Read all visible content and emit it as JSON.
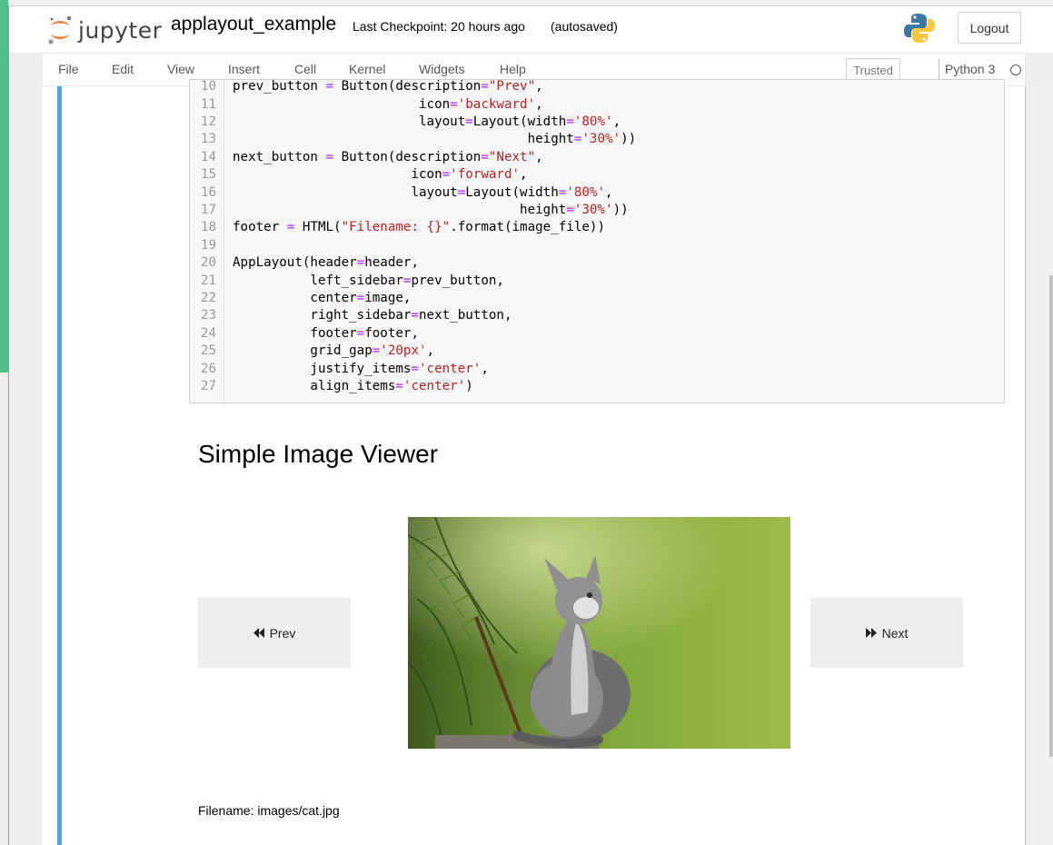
{
  "header": {
    "logo_text": "jupyter",
    "notebook_name": "applayout_example",
    "checkpoint": "Last Checkpoint: 20 hours ago",
    "autosave": "(autosaved)",
    "logout_label": "Logout"
  },
  "menu": {
    "items": [
      "File",
      "Edit",
      "View",
      "Insert",
      "Cell",
      "Kernel",
      "Widgets",
      "Help"
    ],
    "trusted_label": "Trusted",
    "kernel_name": "Python 3"
  },
  "code": {
    "partial_line": "prev_button = Button(description=\"Prev\",",
    "lines": [
      {
        "n": "11",
        "t": "                        icon='backward',"
      },
      {
        "n": "12",
        "t": "                        layout=Layout(width='80%',"
      },
      {
        "n": "13",
        "t": "                                      height='30%'))"
      },
      {
        "n": "14",
        "t": "next_button = Button(description=\"Next\","
      },
      {
        "n": "15",
        "t": "                       icon='forward',"
      },
      {
        "n": "16",
        "t": "                       layout=Layout(width='80%',"
      },
      {
        "n": "17",
        "t": "                                     height='30%'))"
      },
      {
        "n": "18",
        "t": "footer = HTML(\"Filename: {}\".format(image_file))"
      },
      {
        "n": "19",
        "t": ""
      },
      {
        "n": "20",
        "t": "AppLayout(header=header,"
      },
      {
        "n": "21",
        "t": "          left_sidebar=prev_button,"
      },
      {
        "n": "22",
        "t": "          center=image,"
      },
      {
        "n": "23",
        "t": "          right_sidebar=next_button,"
      },
      {
        "n": "24",
        "t": "          footer=footer,"
      },
      {
        "n": "25",
        "t": "          grid_gap='20px',"
      },
      {
        "n": "26",
        "t": "          justify_items='center',"
      },
      {
        "n": "27",
        "t": "          align_items='center')"
      }
    ]
  },
  "output": {
    "title": "Simple Image Viewer",
    "prev_label": "Prev",
    "next_label": "Next",
    "footer": "Filename: images/cat.jpg"
  },
  "colors": {
    "cell_bar": "#42a5f5",
    "string": "#ba2121",
    "operator": "#aa22ff",
    "button_bg": "#eeeeee"
  },
  "icons": {
    "jupyter": "jupyter-logo-icon",
    "python": "python-logo-icon",
    "kernel_status": "kernel-idle-circle-icon",
    "prev": "backward-icon",
    "next": "forward-icon"
  }
}
